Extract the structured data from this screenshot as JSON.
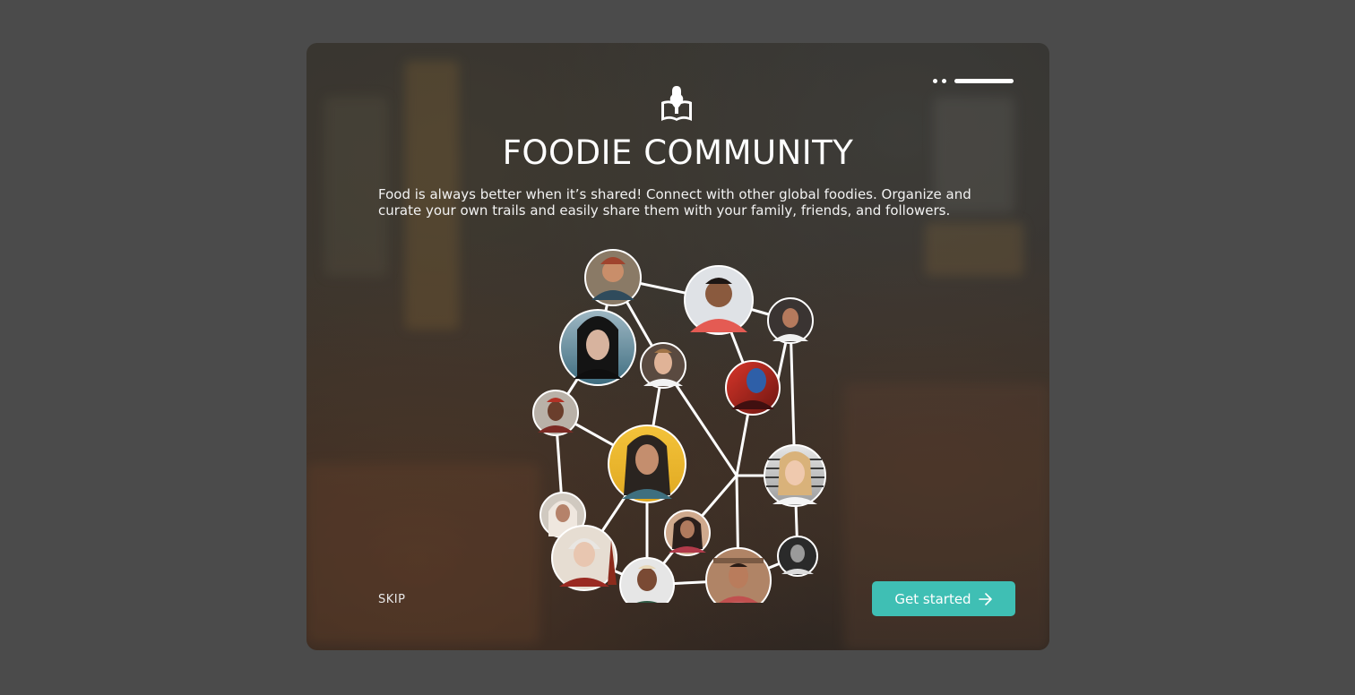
{
  "onboarding": {
    "title": "FOODIE COMMUNITY",
    "description": "Food is always better when it’s shared! Connect with other global foodies.  Organize and curate your own trails and easily share them with your family, friends, and followers.",
    "skip_label": "SKIP",
    "cta_label": "Get started",
    "pager": {
      "total_steps": 3,
      "active_step": 3
    }
  },
  "icons": {
    "logo": "book-with-whisk-icon",
    "cta_arrow": "arrow-right-icon"
  },
  "colors": {
    "backdrop": "#4b4b4b",
    "accent": "#3fbfb4",
    "text": "#ffffff"
  },
  "community_network": {
    "member_count": 16
  }
}
